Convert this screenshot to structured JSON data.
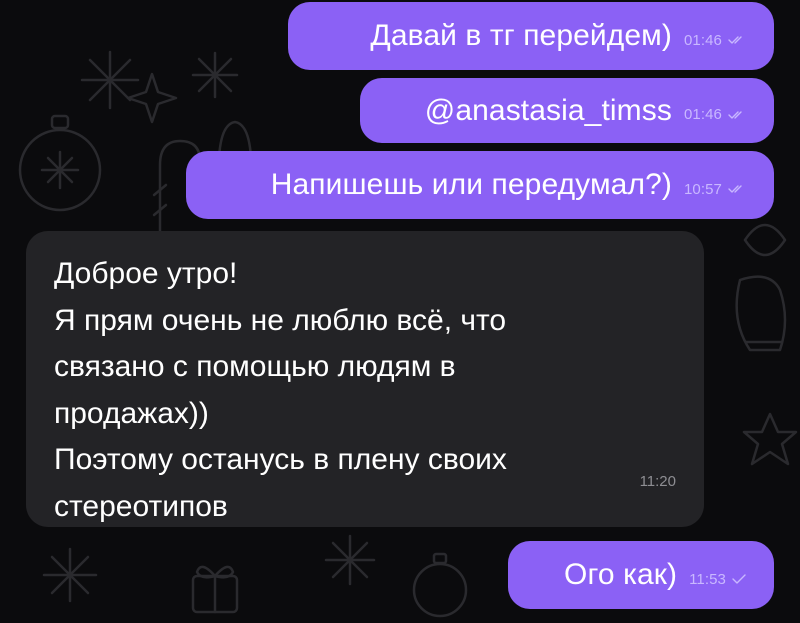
{
  "messages": [
    {
      "direction": "outgoing",
      "text": "Давай в тг перейдем)",
      "time": "01:46",
      "status_icon": "double-check-icon"
    },
    {
      "direction": "outgoing",
      "text": "@anastasia_timss",
      "time": "01:46",
      "status_icon": "double-check-icon"
    },
    {
      "direction": "outgoing",
      "text": "Напишешь или передумал?)",
      "time": "10:57",
      "status_icon": "double-check-icon"
    },
    {
      "direction": "incoming",
      "lines": [
        "Доброе утро!",
        "Я прям очень не люблю всё, что",
        "связано с помощью людям в",
        "продажах))",
        "Поэтому останусь в плену своих",
        "стереотипов"
      ],
      "time": "11:20"
    },
    {
      "direction": "outgoing",
      "text": "Ого как)",
      "time": "11:53",
      "status_icon": "check-icon"
    }
  ],
  "colors": {
    "background": "#0b0b0d",
    "outgoing_bubble": "#8b61f5",
    "incoming_bubble": "#232326",
    "outgoing_meta": "#c9b8ff",
    "incoming_meta": "#8e8e93",
    "wallpaper_doodle": "#2a2a2e"
  }
}
